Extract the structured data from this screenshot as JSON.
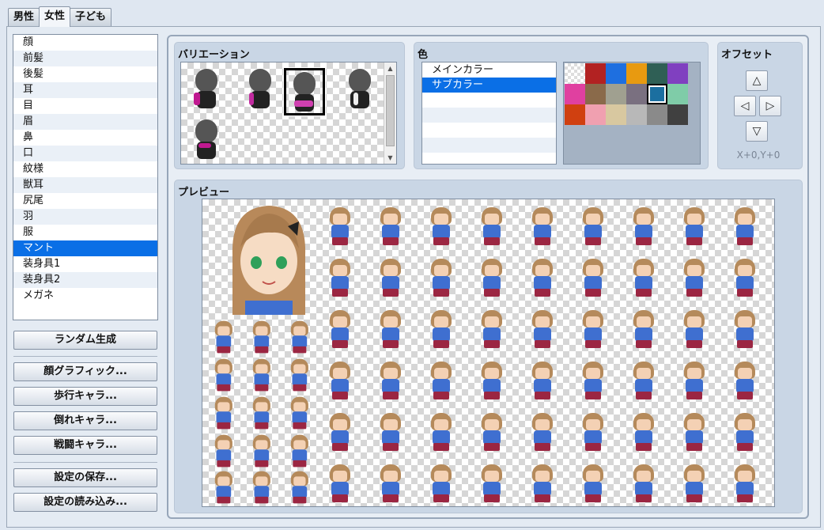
{
  "tabs": [
    "男性",
    "女性",
    "子ども"
  ],
  "active_tab": 1,
  "parts": [
    "顔",
    "前髪",
    "後髪",
    "耳",
    "目",
    "眉",
    "鼻",
    "口",
    "紋様",
    "獣耳",
    "尻尾",
    "羽",
    "服",
    "マント",
    "装身具1",
    "装身具2",
    "メガネ"
  ],
  "selected_part": 13,
  "buttons": {
    "random": "ランダム生成",
    "face": "顔グラフィック...",
    "walk": "歩行キャラ...",
    "damage": "倒れキャラ...",
    "battle": "戦闘キャラ...",
    "save": "設定の保存...",
    "load": "設定の読み込み..."
  },
  "variation": {
    "title": "バリエーション",
    "selected_index": 2
  },
  "color": {
    "title": "色",
    "items": [
      "メインカラー",
      "サブカラー"
    ],
    "selected_item": 1,
    "swatches": [
      "#ffffff",
      "#b22222",
      "#1e6fe0",
      "#e89a10",
      "#2f5f55",
      "#8040c0",
      "#e040a0",
      "#8a6a4a",
      "#a0a090",
      "#7a7080",
      "#1b6fa0",
      "#7fcca8",
      "#d04010",
      "#f0a0b0",
      "#d8c8a0",
      "#b8b8b8",
      "#8a8a8a",
      "#404040"
    ],
    "selected_swatch": 10
  },
  "offset": {
    "title": "オフセット",
    "up": "up-arrow",
    "left": "left-arrow",
    "right": "right-arrow",
    "down": "down-arrow",
    "value": "X+0,Y+0"
  },
  "preview": {
    "title": "プレビュー"
  }
}
